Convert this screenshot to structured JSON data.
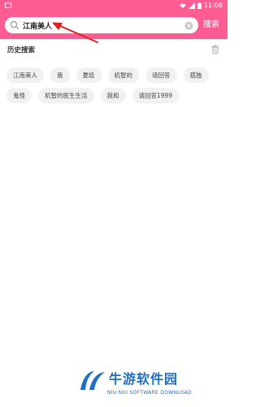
{
  "status_bar": {
    "time": "11:08"
  },
  "search": {
    "value": "江南美人",
    "button_label": "搜索"
  },
  "history": {
    "title": "历史搜索",
    "items": [
      "江南美人",
      "我",
      "夏娃",
      "机智的",
      "请回答",
      "孤独",
      "鬼怪",
      "机智的医生生活",
      "我和",
      "请回答1999"
    ]
  },
  "watermark": {
    "title": "牛游软件园",
    "subtitle": "NIU NIU SOFTWARE DOWNLOAD"
  },
  "colors": {
    "accent": "#ff5c93",
    "brand": "#1f6fc4"
  }
}
